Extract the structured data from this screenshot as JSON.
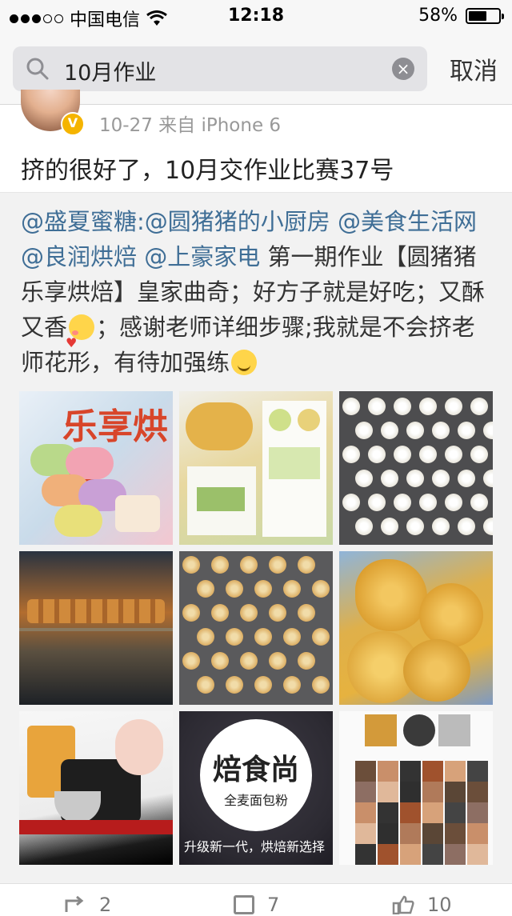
{
  "status_bar": {
    "carrier": "中国电信",
    "time": "12:18",
    "battery": "58%",
    "battery_level": 0.58
  },
  "search": {
    "query": "10月作业",
    "cancel_label": "取消"
  },
  "post": {
    "meta": "10-27  来自 iPhone 6",
    "text": "挤的很好了，10月交作业比赛37号"
  },
  "repost": {
    "mention_1": "@盛夏蜜糖",
    "sep": ":",
    "mention_2": "@圆猪猪的小厨房",
    "mention_3": "@美食生活网",
    "mention_4": "@良润烘焙",
    "mention_5": "@上豪家电",
    "body_1": " 第一期作业【圆猪猪乐享烘焙】皇家曲奇；好方子就是好吃；又酥又香",
    "body_2": "；感谢老师详细步骤;我就是不会挤老师花形，有待加强练",
    "photo1_title": "乐享烘焙",
    "photo8_title": "焙食尚",
    "photo8_subtitle": "全麦面包粉",
    "photo8_caption": "升级新一代，烘焙新选择"
  },
  "actions": {
    "repost_count": "2",
    "comment_count": "7",
    "like_count": "10"
  }
}
